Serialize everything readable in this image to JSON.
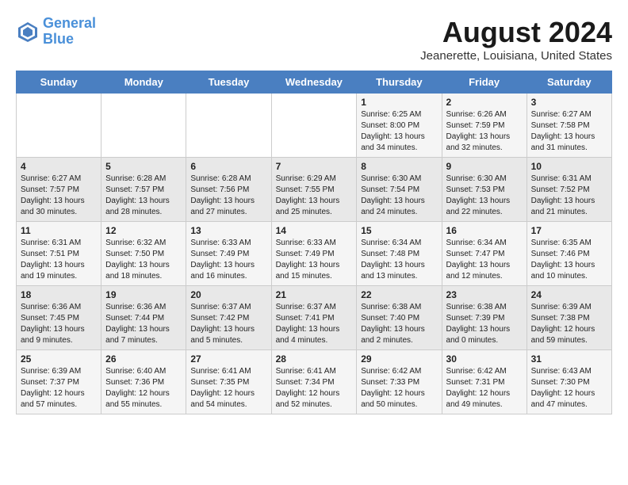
{
  "header": {
    "logo_line1": "General",
    "logo_line2": "Blue",
    "month_year": "August 2024",
    "location": "Jeanerette, Louisiana, United States"
  },
  "calendar": {
    "days_of_week": [
      "Sunday",
      "Monday",
      "Tuesday",
      "Wednesday",
      "Thursday",
      "Friday",
      "Saturday"
    ],
    "weeks": [
      [
        {
          "day": "",
          "detail": ""
        },
        {
          "day": "",
          "detail": ""
        },
        {
          "day": "",
          "detail": ""
        },
        {
          "day": "",
          "detail": ""
        },
        {
          "day": "1",
          "detail": "Sunrise: 6:25 AM\nSunset: 8:00 PM\nDaylight: 13 hours\nand 34 minutes."
        },
        {
          "day": "2",
          "detail": "Sunrise: 6:26 AM\nSunset: 7:59 PM\nDaylight: 13 hours\nand 32 minutes."
        },
        {
          "day": "3",
          "detail": "Sunrise: 6:27 AM\nSunset: 7:58 PM\nDaylight: 13 hours\nand 31 minutes."
        }
      ],
      [
        {
          "day": "4",
          "detail": "Sunrise: 6:27 AM\nSunset: 7:57 PM\nDaylight: 13 hours\nand 30 minutes."
        },
        {
          "day": "5",
          "detail": "Sunrise: 6:28 AM\nSunset: 7:57 PM\nDaylight: 13 hours\nand 28 minutes."
        },
        {
          "day": "6",
          "detail": "Sunrise: 6:28 AM\nSunset: 7:56 PM\nDaylight: 13 hours\nand 27 minutes."
        },
        {
          "day": "7",
          "detail": "Sunrise: 6:29 AM\nSunset: 7:55 PM\nDaylight: 13 hours\nand 25 minutes."
        },
        {
          "day": "8",
          "detail": "Sunrise: 6:30 AM\nSunset: 7:54 PM\nDaylight: 13 hours\nand 24 minutes."
        },
        {
          "day": "9",
          "detail": "Sunrise: 6:30 AM\nSunset: 7:53 PM\nDaylight: 13 hours\nand 22 minutes."
        },
        {
          "day": "10",
          "detail": "Sunrise: 6:31 AM\nSunset: 7:52 PM\nDaylight: 13 hours\nand 21 minutes."
        }
      ],
      [
        {
          "day": "11",
          "detail": "Sunrise: 6:31 AM\nSunset: 7:51 PM\nDaylight: 13 hours\nand 19 minutes."
        },
        {
          "day": "12",
          "detail": "Sunrise: 6:32 AM\nSunset: 7:50 PM\nDaylight: 13 hours\nand 18 minutes."
        },
        {
          "day": "13",
          "detail": "Sunrise: 6:33 AM\nSunset: 7:49 PM\nDaylight: 13 hours\nand 16 minutes."
        },
        {
          "day": "14",
          "detail": "Sunrise: 6:33 AM\nSunset: 7:49 PM\nDaylight: 13 hours\nand 15 minutes."
        },
        {
          "day": "15",
          "detail": "Sunrise: 6:34 AM\nSunset: 7:48 PM\nDaylight: 13 hours\nand 13 minutes."
        },
        {
          "day": "16",
          "detail": "Sunrise: 6:34 AM\nSunset: 7:47 PM\nDaylight: 13 hours\nand 12 minutes."
        },
        {
          "day": "17",
          "detail": "Sunrise: 6:35 AM\nSunset: 7:46 PM\nDaylight: 13 hours\nand 10 minutes."
        }
      ],
      [
        {
          "day": "18",
          "detail": "Sunrise: 6:36 AM\nSunset: 7:45 PM\nDaylight: 13 hours\nand 9 minutes."
        },
        {
          "day": "19",
          "detail": "Sunrise: 6:36 AM\nSunset: 7:44 PM\nDaylight: 13 hours\nand 7 minutes."
        },
        {
          "day": "20",
          "detail": "Sunrise: 6:37 AM\nSunset: 7:42 PM\nDaylight: 13 hours\nand 5 minutes."
        },
        {
          "day": "21",
          "detail": "Sunrise: 6:37 AM\nSunset: 7:41 PM\nDaylight: 13 hours\nand 4 minutes."
        },
        {
          "day": "22",
          "detail": "Sunrise: 6:38 AM\nSunset: 7:40 PM\nDaylight: 13 hours\nand 2 minutes."
        },
        {
          "day": "23",
          "detail": "Sunrise: 6:38 AM\nSunset: 7:39 PM\nDaylight: 13 hours\nand 0 minutes."
        },
        {
          "day": "24",
          "detail": "Sunrise: 6:39 AM\nSunset: 7:38 PM\nDaylight: 12 hours\nand 59 minutes."
        }
      ],
      [
        {
          "day": "25",
          "detail": "Sunrise: 6:39 AM\nSunset: 7:37 PM\nDaylight: 12 hours\nand 57 minutes."
        },
        {
          "day": "26",
          "detail": "Sunrise: 6:40 AM\nSunset: 7:36 PM\nDaylight: 12 hours\nand 55 minutes."
        },
        {
          "day": "27",
          "detail": "Sunrise: 6:41 AM\nSunset: 7:35 PM\nDaylight: 12 hours\nand 54 minutes."
        },
        {
          "day": "28",
          "detail": "Sunrise: 6:41 AM\nSunset: 7:34 PM\nDaylight: 12 hours\nand 52 minutes."
        },
        {
          "day": "29",
          "detail": "Sunrise: 6:42 AM\nSunset: 7:33 PM\nDaylight: 12 hours\nand 50 minutes."
        },
        {
          "day": "30",
          "detail": "Sunrise: 6:42 AM\nSunset: 7:31 PM\nDaylight: 12 hours\nand 49 minutes."
        },
        {
          "day": "31",
          "detail": "Sunrise: 6:43 AM\nSunset: 7:30 PM\nDaylight: 12 hours\nand 47 minutes."
        }
      ]
    ]
  }
}
